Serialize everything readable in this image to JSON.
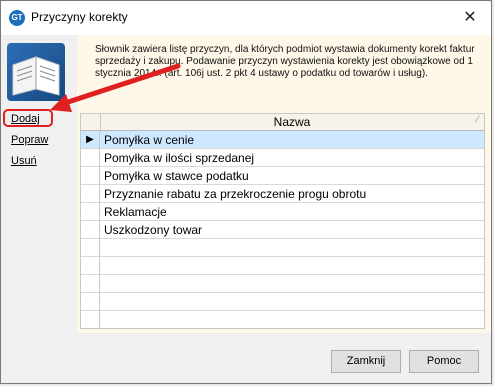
{
  "window": {
    "title": "Przyczyny korekty",
    "app_icon_label": "GT"
  },
  "sidebar": {
    "items": [
      {
        "label": "Dodaj",
        "highlighted": true
      },
      {
        "label": "Popraw"
      },
      {
        "label": "Usuń"
      }
    ]
  },
  "main": {
    "description": "Słownik zawiera listę przyczyn, dla których podmiot wystawia dokumenty korekt faktur sprzedaży i zakupu. Podawanie przyczyn wystawienia korekty jest obowiązkowe od 1 stycznia 2014r. (art. 106j ust. 2 pkt 4 ustawy o podatku od towarów i usług)."
  },
  "grid": {
    "column_header": "Nazwa",
    "rows": [
      {
        "name": "Pomyłka w cenie",
        "selected": true
      },
      {
        "name": "Pomyłka w ilości sprzedanej"
      },
      {
        "name": "Pomyłka w stawce podatku"
      },
      {
        "name": "Przyznanie rabatu za przekroczenie progu obrotu"
      },
      {
        "name": "Reklamacje"
      },
      {
        "name": "Uszkodzony towar"
      },
      {
        "name": ""
      },
      {
        "name": ""
      },
      {
        "name": ""
      },
      {
        "name": ""
      },
      {
        "name": ""
      }
    ]
  },
  "footer": {
    "close_label": "Zamknij",
    "help_label": "Pomoc"
  },
  "colors": {
    "accent": "#1f6fbf",
    "selection": "#cde8ff",
    "annotation": "#e02020",
    "content_background": "#fff8e8"
  },
  "icons": {
    "close": "close-icon",
    "book": "book-icon",
    "annotation_arrow": "arrow-icon",
    "selected_row": "triangle-right-icon"
  }
}
